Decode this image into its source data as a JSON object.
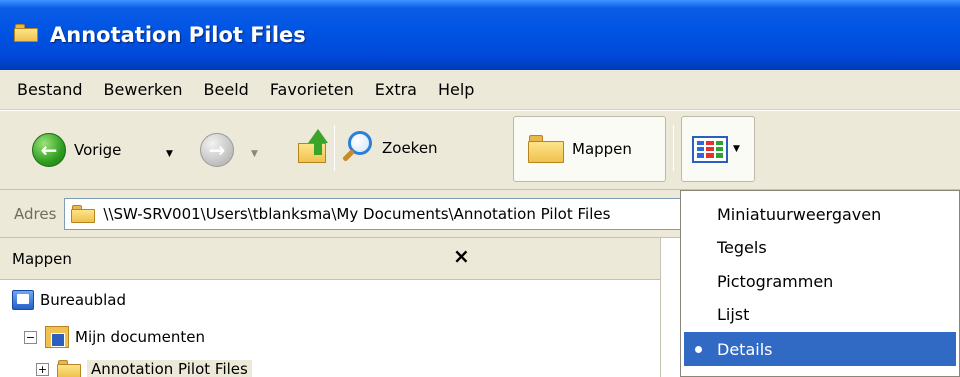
{
  "window": {
    "title": "Annotation Pilot Files",
    "title_icon": "folder-window-icon"
  },
  "menubar": {
    "items": [
      "Bestand",
      "Bewerken",
      "Beeld",
      "Favorieten",
      "Extra",
      "Help"
    ]
  },
  "toolbar": {
    "back_label": "Vorige",
    "back_icon": "back-arrow-icon",
    "forward_icon": "forward-arrow-icon",
    "forward_enabled": false,
    "up_icon": "folder-up-icon",
    "search_label": "Zoeken",
    "search_icon": "search-icon",
    "folders_label": "Mappen",
    "folders_icon": "folders-icon",
    "folders_active": true,
    "views_icon": "views-icon"
  },
  "address": {
    "label": "Adres",
    "value": "\\\\SW-SRV001\\Users\\tblanksma\\My Documents\\Annotation Pilot Files"
  },
  "folders_pane": {
    "title": "Mappen",
    "close_glyph": "×",
    "tree": [
      {
        "label": "Bureaublad",
        "icon": "desktop-icon",
        "expander": ""
      },
      {
        "label": "Mijn documenten",
        "icon": "my-documents-icon",
        "expander": "−"
      },
      {
        "label": "Annotation Pilot Files",
        "icon": "folder-icon",
        "expander": "+",
        "selected": true
      }
    ]
  },
  "views_menu": {
    "options": [
      {
        "label": "Miniatuurweergaven",
        "selected": false
      },
      {
        "label": "Tegels",
        "selected": false
      },
      {
        "label": "Pictogrammen",
        "selected": false
      },
      {
        "label": "Lijst",
        "selected": false
      },
      {
        "label": "Details",
        "selected": true
      }
    ]
  },
  "colors": {
    "titlebar": "#0054e3",
    "menu_selected": "#316ac5",
    "chrome": "#ece9d8"
  }
}
